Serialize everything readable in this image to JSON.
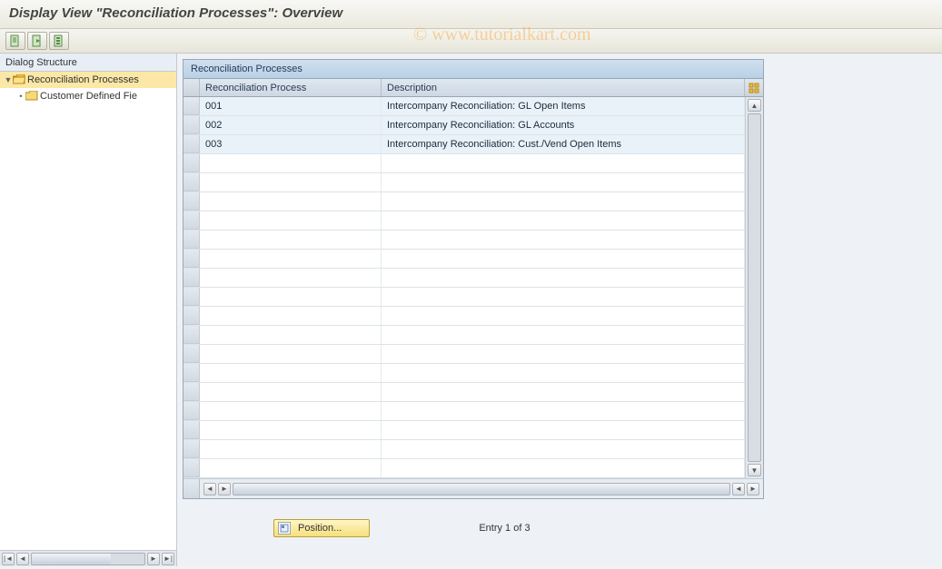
{
  "title": "Display View \"Reconciliation Processes\": Overview",
  "watermark": "© www.tutorialkart.com",
  "toolbar": {
    "btn1": "expand-all-icon",
    "btn2": "collapse-all-icon",
    "btn3": "select-layout-icon"
  },
  "tree": {
    "header": "Dialog Structure",
    "items": [
      {
        "label": "Reconciliation Processes",
        "open": true,
        "selected": true,
        "level": 0
      },
      {
        "label": "Customer Defined Fie",
        "open": false,
        "selected": false,
        "level": 1
      }
    ]
  },
  "table": {
    "title": "Reconciliation Processes",
    "columns": {
      "c1": "Reconciliation Process",
      "c2": "Description"
    },
    "rows": [
      {
        "c1": "001",
        "c2": "Intercompany Reconciliation: GL Open Items"
      },
      {
        "c1": "002",
        "c2": "Intercompany Reconciliation: GL Accounts"
      },
      {
        "c1": "003",
        "c2": "Intercompany Reconciliation: Cust./Vend Open Items"
      }
    ],
    "empty_rows": 17
  },
  "footer": {
    "position_button": "Position...",
    "entry_text": "Entry 1 of 3"
  }
}
